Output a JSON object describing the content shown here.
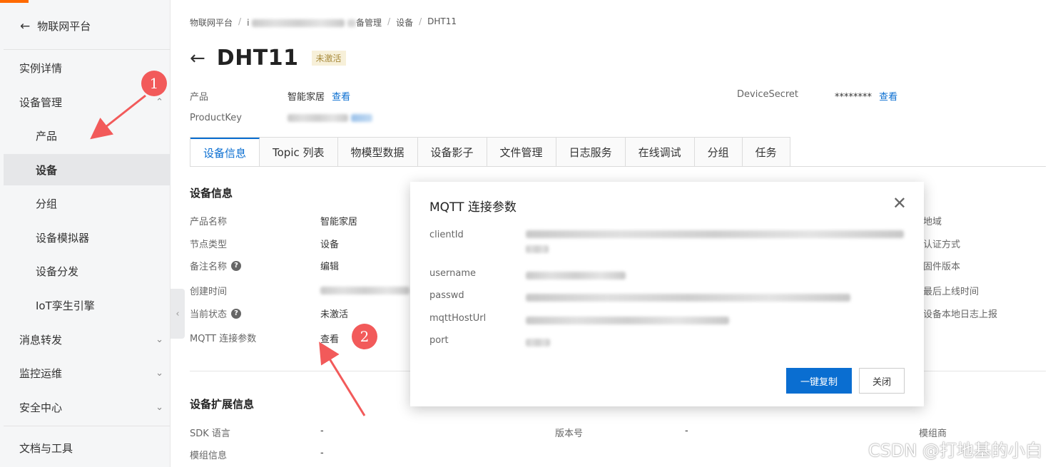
{
  "sidebar": {
    "back_label": "物联网平台",
    "items": [
      {
        "label": "实例详情"
      },
      {
        "label": "设备管理"
      },
      {
        "label": "产品"
      },
      {
        "label": "设备"
      },
      {
        "label": "分组"
      },
      {
        "label": "设备模拟器"
      },
      {
        "label": "设备分发"
      },
      {
        "label": "IoT孪生引擎"
      },
      {
        "label": "消息转发"
      },
      {
        "label": "监控运维"
      },
      {
        "label": "安全中心"
      },
      {
        "label": "文档与工具"
      }
    ]
  },
  "breadcrumb": {
    "root": "物联网平台",
    "device_mgmt_suffix": "备管理",
    "devices": "设备",
    "current": "DHT11"
  },
  "header": {
    "title": "DHT11",
    "status_badge": "未激活",
    "product_label": "产品",
    "product_value": "智能家居",
    "view_link": "查看",
    "productkey_label": "ProductKey",
    "device_secret_label": "DeviceSecret",
    "device_secret_value": "********",
    "device_secret_view": "查看"
  },
  "tabs": [
    "设备信息",
    "Topic 列表",
    "物模型数据",
    "设备影子",
    "文件管理",
    "日志服务",
    "在线调试",
    "分组",
    "任务"
  ],
  "device_info": {
    "title": "设备信息",
    "rows": [
      {
        "label": "产品名称",
        "value": "智能家居"
      },
      {
        "label": "节点类型",
        "value": "设备"
      },
      {
        "label": "备注名称",
        "value": "编辑"
      },
      {
        "label": "创建时间",
        "value": ""
      },
      {
        "label": "当前状态",
        "value": "未激活"
      },
      {
        "label": "MQTT 连接参数",
        "value": "查看"
      }
    ],
    "right_labels": [
      "地域",
      "认证方式",
      "固件版本",
      "最后上线时间",
      "设备本地日志上报"
    ]
  },
  "extended_info": {
    "title": "设备扩展信息",
    "sdk_label": "SDK 语言",
    "sdk_value": "-",
    "version_label": "版本号",
    "version_value": "-",
    "module_vendor_label": "模组商",
    "module_info_label": "模组信息",
    "module_info_value": "-"
  },
  "dialog": {
    "title": "MQTT 连接参数",
    "fields": [
      "clientId",
      "username",
      "passwd",
      "mqttHostUrl",
      "port"
    ],
    "copy_button": "一键复制",
    "close_button": "关闭"
  },
  "annotations": {
    "marker1": "1",
    "marker2": "2"
  },
  "watermark": "CSDN @打地基的小白",
  "colors": {
    "accent": "#0a6ed1",
    "marker": "#f25a5a",
    "brand_orange": "#ff6a00"
  }
}
